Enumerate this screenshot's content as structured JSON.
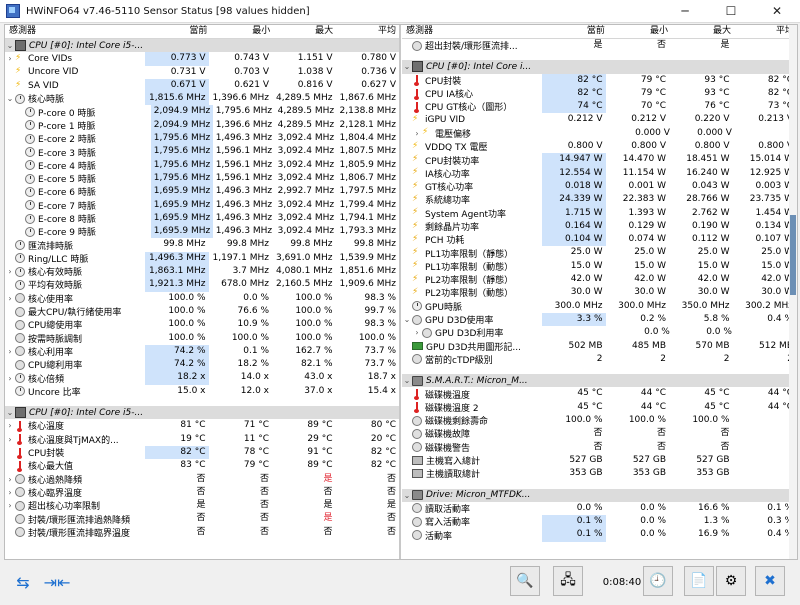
{
  "window": {
    "title": "HWiNFO64 v7.46-5110 Sensor Status [98 values hidden]"
  },
  "header": {
    "name": "感測器",
    "cur": "當前",
    "min": "最小",
    "max": "最大",
    "avg": "平均"
  },
  "left_rows": [
    {
      "type": "group",
      "exp": "⌄",
      "icon": "cpu",
      "name": "CPU [#0]: Intel Core i5-...",
      "v": [
        "",
        "",
        "",
        ""
      ]
    },
    {
      "exp": "›",
      "icon": "volt",
      "name": "Core VIDs",
      "v": [
        "0.773 V",
        "0.743 V",
        "1.151 V",
        "0.780 V"
      ],
      "hl": true
    },
    {
      "exp": "",
      "icon": "volt",
      "name": "Uncore VID",
      "v": [
        "0.731 V",
        "0.703 V",
        "1.038 V",
        "0.736 V"
      ]
    },
    {
      "exp": "",
      "icon": "volt",
      "name": "SA VID",
      "v": [
        "0.671 V",
        "0.621 V",
        "0.816 V",
        "0.627 V"
      ],
      "hl": true
    },
    {
      "exp": "⌄",
      "icon": "clock",
      "name": "核心時脈",
      "v": [
        "1,815.6 MHz",
        "1,396.6 MHz",
        "4,289.5 MHz",
        "1,867.6 MHz"
      ],
      "hl": true
    },
    {
      "exp": "",
      "icon": "clock",
      "name": "P-core 0 時脈",
      "v": [
        "2,094.9 MHz",
        "1,795.6 MHz",
        "4,289.5 MHz",
        "2,138.8 MHz"
      ],
      "hl": true,
      "ind": true
    },
    {
      "exp": "",
      "icon": "clock",
      "name": "P-core 1 時脈",
      "v": [
        "2,094.9 MHz",
        "1,396.6 MHz",
        "4,289.5 MHz",
        "2,128.1 MHz"
      ],
      "hl": true,
      "ind": true
    },
    {
      "exp": "",
      "icon": "clock",
      "name": "E-core 2 時脈",
      "v": [
        "1,795.6 MHz",
        "1,496.3 MHz",
        "3,092.4 MHz",
        "1,804.4 MHz"
      ],
      "hl": true,
      "ind": true
    },
    {
      "exp": "",
      "icon": "clock",
      "name": "E-core 3 時脈",
      "v": [
        "1,795.6 MHz",
        "1,596.1 MHz",
        "3,092.4 MHz",
        "1,807.5 MHz"
      ],
      "hl": true,
      "ind": true
    },
    {
      "exp": "",
      "icon": "clock",
      "name": "E-core 4 時脈",
      "v": [
        "1,795.6 MHz",
        "1,596.1 MHz",
        "3,092.4 MHz",
        "1,805.9 MHz"
      ],
      "hl": true,
      "ind": true
    },
    {
      "exp": "",
      "icon": "clock",
      "name": "E-core 5 時脈",
      "v": [
        "1,795.6 MHz",
        "1,596.1 MHz",
        "3,092.4 MHz",
        "1,806.7 MHz"
      ],
      "hl": true,
      "ind": true
    },
    {
      "exp": "",
      "icon": "clock",
      "name": "E-core 6 時脈",
      "v": [
        "1,695.9 MHz",
        "1,496.3 MHz",
        "2,992.7 MHz",
        "1,797.5 MHz"
      ],
      "hl": true,
      "ind": true
    },
    {
      "exp": "",
      "icon": "clock",
      "name": "E-core 7 時脈",
      "v": [
        "1,695.9 MHz",
        "1,496.3 MHz",
        "3,092.4 MHz",
        "1,799.4 MHz"
      ],
      "hl": true,
      "ind": true
    },
    {
      "exp": "",
      "icon": "clock",
      "name": "E-core 8 時脈",
      "v": [
        "1,695.9 MHz",
        "1,496.3 MHz",
        "3,092.4 MHz",
        "1,794.1 MHz"
      ],
      "hl": true,
      "ind": true
    },
    {
      "exp": "",
      "icon": "clock",
      "name": "E-core 9 時脈",
      "v": [
        "1,695.9 MHz",
        "1,496.3 MHz",
        "3,092.4 MHz",
        "1,793.3 MHz"
      ],
      "hl": true,
      "ind": true
    },
    {
      "exp": "",
      "icon": "clock",
      "name": "匯流排時脈",
      "v": [
        "99.8 MHz",
        "99.8 MHz",
        "99.8 MHz",
        "99.8 MHz"
      ]
    },
    {
      "exp": "",
      "icon": "clock",
      "name": "Ring/LLC 時脈",
      "v": [
        "1,496.3 MHz",
        "1,197.1 MHz",
        "3,691.0 MHz",
        "1,539.9 MHz"
      ],
      "hl": true
    },
    {
      "exp": "›",
      "icon": "clock",
      "name": "核心有效時脈",
      "v": [
        "1,863.1 MHz",
        "3.7 MHz",
        "4,080.1 MHz",
        "1,851.6 MHz"
      ],
      "hl": true
    },
    {
      "exp": "",
      "icon": "clock",
      "name": "平均有效時脈",
      "v": [
        "1,921.3 MHz",
        "678.0 MHz",
        "2,160.5 MHz",
        "1,909.6 MHz"
      ],
      "hl": true
    },
    {
      "exp": "›",
      "icon": "usage",
      "name": "核心使用率",
      "v": [
        "100.0 %",
        "0.0 %",
        "100.0 %",
        "98.3 %"
      ]
    },
    {
      "exp": "",
      "icon": "usage",
      "name": "最大CPU/執行緒使用率",
      "v": [
        "100.0 %",
        "76.6 %",
        "100.0 %",
        "99.7 %"
      ]
    },
    {
      "exp": "",
      "icon": "usage",
      "name": "CPU總使用率",
      "v": [
        "100.0 %",
        "10.9 %",
        "100.0 %",
        "98.3 %"
      ]
    },
    {
      "exp": "",
      "icon": "usage",
      "name": "按需時脈調制",
      "v": [
        "100.0 %",
        "100.0 %",
        "100.0 %",
        "100.0 %"
      ]
    },
    {
      "exp": "›",
      "icon": "usage",
      "name": "核心利用率",
      "v": [
        "74.2 %",
        "0.1 %",
        "162.7 %",
        "73.7 %"
      ],
      "hl": true
    },
    {
      "exp": "",
      "icon": "usage",
      "name": "CPU總利用率",
      "v": [
        "74.2 %",
        "18.2 %",
        "82.1 %",
        "73.7 %"
      ],
      "hl": true
    },
    {
      "exp": "›",
      "icon": "clock",
      "name": "核心倍頻",
      "v": [
        "18.2 x",
        "14.0 x",
        "43.0 x",
        "18.7 x"
      ],
      "hl": true
    },
    {
      "exp": "",
      "icon": "clock",
      "name": "Uncore 比率",
      "v": [
        "15.0 x",
        "12.0 x",
        "37.0 x",
        "15.4 x"
      ]
    },
    {
      "type": "gap"
    },
    {
      "type": "group",
      "exp": "⌄",
      "icon": "cpu",
      "name": "CPU [#0]: Intel Core i5-...",
      "v": [
        "",
        "",
        "",
        ""
      ]
    },
    {
      "exp": "›",
      "icon": "therm",
      "name": "核心溫度",
      "v": [
        "81 °C",
        "71 °C",
        "89 °C",
        "80 °C"
      ]
    },
    {
      "exp": "›",
      "icon": "therm",
      "name": "核心溫度與TjMAX的...",
      "v": [
        "19 °C",
        "11 °C",
        "29 °C",
        "20 °C"
      ]
    },
    {
      "exp": "",
      "icon": "therm",
      "name": "CPU封裝",
      "v": [
        "82 °C",
        "78 °C",
        "91 °C",
        "82 °C"
      ],
      "hl": true
    },
    {
      "exp": "",
      "icon": "therm",
      "name": "核心最大值",
      "v": [
        "83 °C",
        "79 °C",
        "89 °C",
        "82 °C"
      ]
    },
    {
      "exp": "›",
      "icon": "usage",
      "name": "核心過熱降頻",
      "v": [
        "否",
        "否",
        "是",
        "否"
      ],
      "redmax": true
    },
    {
      "exp": "›",
      "icon": "usage",
      "name": "核心臨界溫度",
      "v": [
        "否",
        "否",
        "否",
        "否"
      ]
    },
    {
      "exp": "›",
      "icon": "usage",
      "name": "超出核心功率限制",
      "v": [
        "是",
        "否",
        "是",
        "是"
      ]
    },
    {
      "exp": "",
      "icon": "usage",
      "name": "封裝/環形匯流排過熱降頻",
      "v": [
        "否",
        "否",
        "是",
        "否"
      ],
      "redmax": true
    },
    {
      "exp": "",
      "icon": "usage",
      "name": "封裝/環形匯流排臨界溫度",
      "v": [
        "否",
        "否",
        "否",
        "否"
      ]
    }
  ],
  "right_rows": [
    {
      "exp": "",
      "icon": "usage",
      "name": "超出封裝/環形匯流排...",
      "v": [
        "是",
        "否",
        "是",
        ""
      ]
    },
    {
      "type": "gap"
    },
    {
      "type": "group",
      "exp": "⌄",
      "icon": "cpu",
      "name": "CPU [#0]: Intel Core i...",
      "v": [
        "",
        "",
        "",
        ""
      ]
    },
    {
      "exp": "",
      "icon": "therm",
      "name": "CPU封裝",
      "v": [
        "82 °C",
        "79 °C",
        "93 °C",
        "82 °C"
      ],
      "hl": true
    },
    {
      "exp": "",
      "icon": "therm",
      "name": "CPU IA核心",
      "v": [
        "82 °C",
        "79 °C",
        "93 °C",
        "82 °C"
      ],
      "hl": true
    },
    {
      "exp": "",
      "icon": "therm",
      "name": "CPU GT核心（圖形）",
      "v": [
        "74 °C",
        "70 °C",
        "76 °C",
        "73 °C"
      ],
      "hl": true
    },
    {
      "exp": "",
      "icon": "volt",
      "name": "iGPU VID",
      "v": [
        "0.212 V",
        "0.212 V",
        "0.220 V",
        "0.213 V"
      ]
    },
    {
      "exp": "›",
      "icon": "volt",
      "name": "電壓偏移",
      "v": [
        "",
        "0.000 V",
        "0.000 V",
        ""
      ],
      "ind": true
    },
    {
      "exp": "",
      "icon": "volt",
      "name": "VDDQ TX 電壓",
      "v": [
        "0.800 V",
        "0.800 V",
        "0.800 V",
        "0.800 V"
      ]
    },
    {
      "exp": "",
      "icon": "power",
      "name": "CPU封裝功率",
      "v": [
        "14.947 W",
        "14.470 W",
        "18.451 W",
        "15.014 W"
      ],
      "hl": true
    },
    {
      "exp": "",
      "icon": "power",
      "name": "IA核心功率",
      "v": [
        "12.554 W",
        "11.154 W",
        "16.240 W",
        "12.925 W"
      ],
      "hl": true
    },
    {
      "exp": "",
      "icon": "power",
      "name": "GT核心功率",
      "v": [
        "0.018 W",
        "0.001 W",
        "0.043 W",
        "0.003 W"
      ],
      "hl": true
    },
    {
      "exp": "",
      "icon": "power",
      "name": "系統總功率",
      "v": [
        "24.339 W",
        "22.383 W",
        "28.766 W",
        "23.735 W"
      ],
      "hl": true
    },
    {
      "exp": "",
      "icon": "power",
      "name": "System Agent功率",
      "v": [
        "1.715 W",
        "1.393 W",
        "2.762 W",
        "1.454 W"
      ],
      "hl": true
    },
    {
      "exp": "",
      "icon": "power",
      "name": "剩餘晶片功率",
      "v": [
        "0.164 W",
        "0.129 W",
        "0.190 W",
        "0.134 W"
      ],
      "hl": true
    },
    {
      "exp": "",
      "icon": "power",
      "name": "PCH 功耗",
      "v": [
        "0.104 W",
        "0.074 W",
        "0.112 W",
        "0.107 W"
      ],
      "hl": true
    },
    {
      "exp": "",
      "icon": "power",
      "name": "PL1功率限制（靜態）",
      "v": [
        "25.0 W",
        "25.0 W",
        "25.0 W",
        "25.0 W"
      ]
    },
    {
      "exp": "",
      "icon": "power",
      "name": "PL1功率限制（動態）",
      "v": [
        "15.0 W",
        "15.0 W",
        "15.0 W",
        "15.0 W"
      ]
    },
    {
      "exp": "",
      "icon": "power",
      "name": "PL2功率限制（靜態）",
      "v": [
        "42.0 W",
        "42.0 W",
        "42.0 W",
        "42.0 W"
      ]
    },
    {
      "exp": "",
      "icon": "power",
      "name": "PL2功率限制（動態）",
      "v": [
        "30.0 W",
        "30.0 W",
        "30.0 W",
        "30.0 W"
      ]
    },
    {
      "exp": "",
      "icon": "clock",
      "name": "GPU時脈",
      "v": [
        "300.0 MHz",
        "300.0 MHz",
        "350.0 MHz",
        "300.2 MHz"
      ]
    },
    {
      "exp": "⌄",
      "icon": "usage",
      "name": "GPU D3D使用率",
      "v": [
        "3.3 %",
        "0.2 %",
        "5.8 %",
        "0.4 %"
      ],
      "hl": true
    },
    {
      "exp": "›",
      "icon": "usage",
      "name": "GPU D3D利用率",
      "v": [
        "",
        "0.0 %",
        "0.0 %",
        ""
      ],
      "ind": true
    },
    {
      "exp": "",
      "icon": "ram",
      "name": "GPU D3D共用圖形記...",
      "v": [
        "502 MB",
        "485 MB",
        "570 MB",
        "512 MB"
      ]
    },
    {
      "exp": "",
      "icon": "usage",
      "name": "當前的cTDP級別",
      "v": [
        "2",
        "2",
        "2",
        "2"
      ]
    },
    {
      "type": "gap"
    },
    {
      "type": "group",
      "exp": "⌄",
      "icon": "disk",
      "name": "S.M.A.R.T.: Micron_M...",
      "v": [
        "",
        "",
        "",
        ""
      ]
    },
    {
      "exp": "",
      "icon": "therm",
      "name": "磁碟機溫度",
      "v": [
        "45 °C",
        "44 °C",
        "45 °C",
        "44 °C"
      ]
    },
    {
      "exp": "",
      "icon": "therm",
      "name": "磁碟機溫度 2",
      "v": [
        "45 °C",
        "44 °C",
        "45 °C",
        "44 °C"
      ]
    },
    {
      "exp": "",
      "icon": "usage",
      "name": "磁碟機剩餘壽命",
      "v": [
        "100.0 %",
        "100.0 %",
        "100.0 %",
        ""
      ]
    },
    {
      "exp": "",
      "icon": "usage",
      "name": "磁碟機故障",
      "v": [
        "否",
        "否",
        "否",
        ""
      ]
    },
    {
      "exp": "",
      "icon": "usage",
      "name": "磁碟機警告",
      "v": [
        "否",
        "否",
        "否",
        ""
      ]
    },
    {
      "exp": "",
      "icon": "drive",
      "name": "主機寫入總計",
      "v": [
        "527 GB",
        "527 GB",
        "527 GB",
        ""
      ]
    },
    {
      "exp": "",
      "icon": "drive",
      "name": "主機讀取總計",
      "v": [
        "353 GB",
        "353 GB",
        "353 GB",
        ""
      ]
    },
    {
      "type": "gap"
    },
    {
      "type": "group",
      "exp": "⌄",
      "icon": "disk",
      "name": "Drive: Micron_MTFDK...",
      "v": [
        "",
        "",
        "",
        ""
      ]
    },
    {
      "exp": "",
      "icon": "usage",
      "name": "讀取活動率",
      "v": [
        "0.0 %",
        "0.0 %",
        "16.6 %",
        "0.1 %"
      ]
    },
    {
      "exp": "",
      "icon": "usage",
      "name": "寫入活動率",
      "v": [
        "0.1 %",
        "0.0 %",
        "1.3 %",
        "0.3 %"
      ],
      "hl": true
    },
    {
      "exp": "",
      "icon": "usage",
      "name": "活動率",
      "v": [
        "0.1 %",
        "0.0 %",
        "16.9 %",
        "0.4 %"
      ],
      "hl": true
    }
  ],
  "bottom": {
    "timer": "0:08:40"
  },
  "colors": {
    "highlight": "#cfe3fb",
    "alert": "#e0202c",
    "accent": "#1e70d0"
  }
}
